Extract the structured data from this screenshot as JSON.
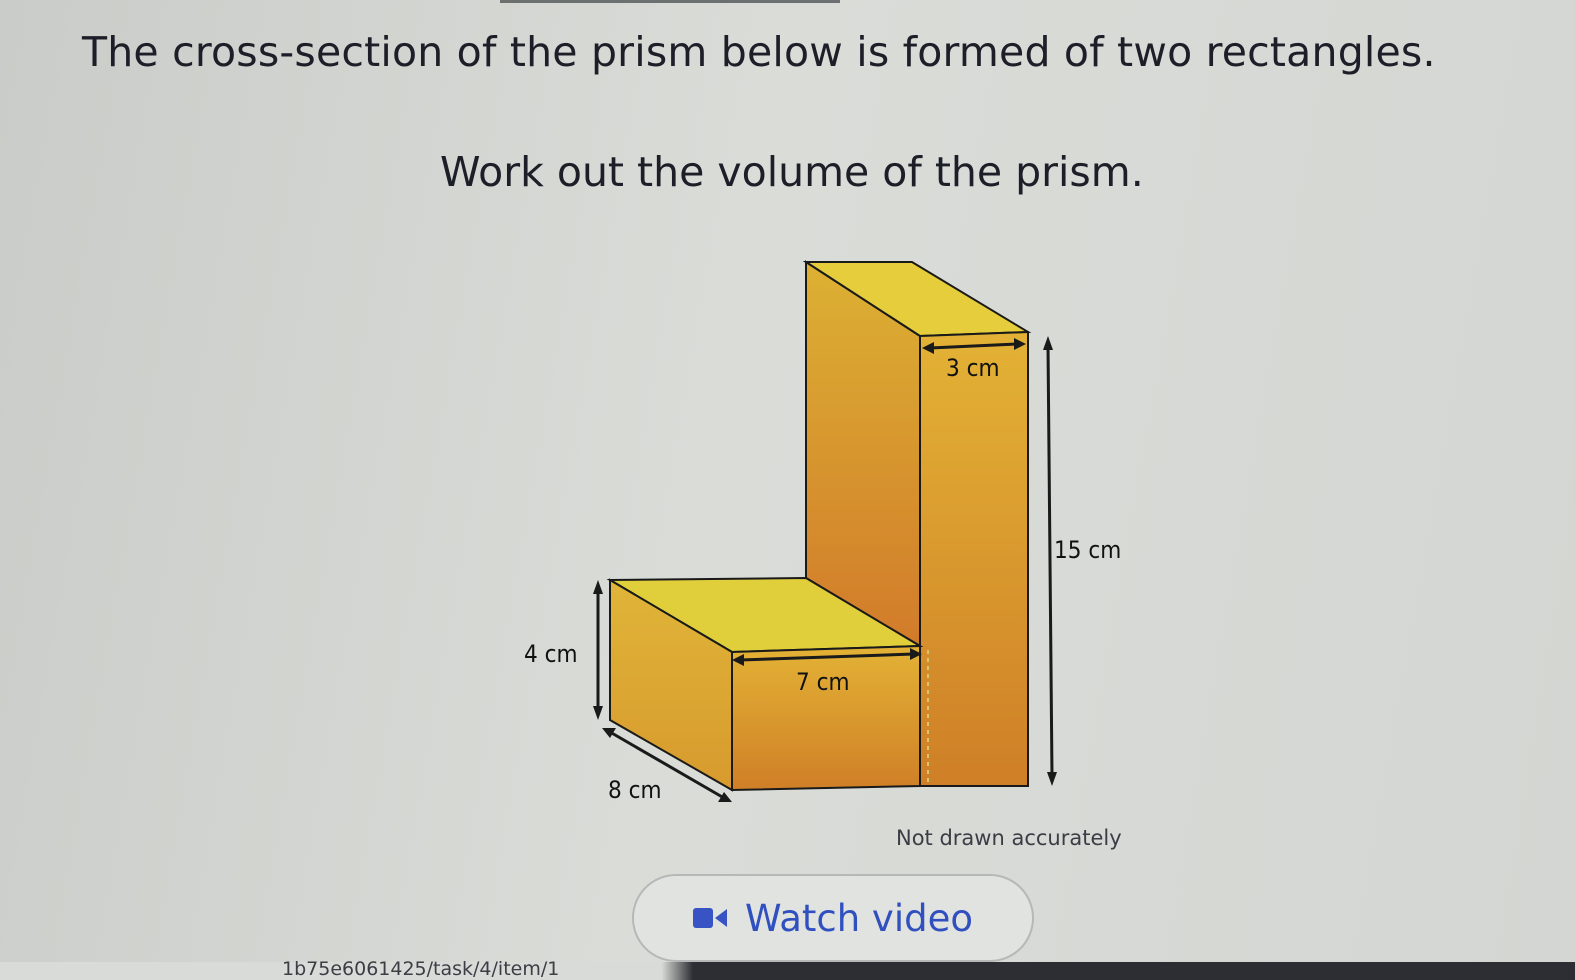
{
  "question": {
    "line1": "The cross-section of the prism below is formed of two rectangles.",
    "line2": "Work out the volume of the prism."
  },
  "figure": {
    "labels": {
      "top_width": "3 cm",
      "height": "15 cm",
      "step_height": "4 cm",
      "step_width": "7 cm",
      "depth": "8 cm"
    },
    "note": "Not drawn accurately",
    "colors": {
      "top_face": "#e3cc3a",
      "front_face": "#cf8a2a",
      "side_face": "#d8b236",
      "edge": "#1a1a1a"
    }
  },
  "video_button": {
    "label": "Watch video",
    "icon": "video-camera-icon",
    "color": "#3050c0"
  },
  "url_fragment": "1b75e6061425/task/4/item/1"
}
